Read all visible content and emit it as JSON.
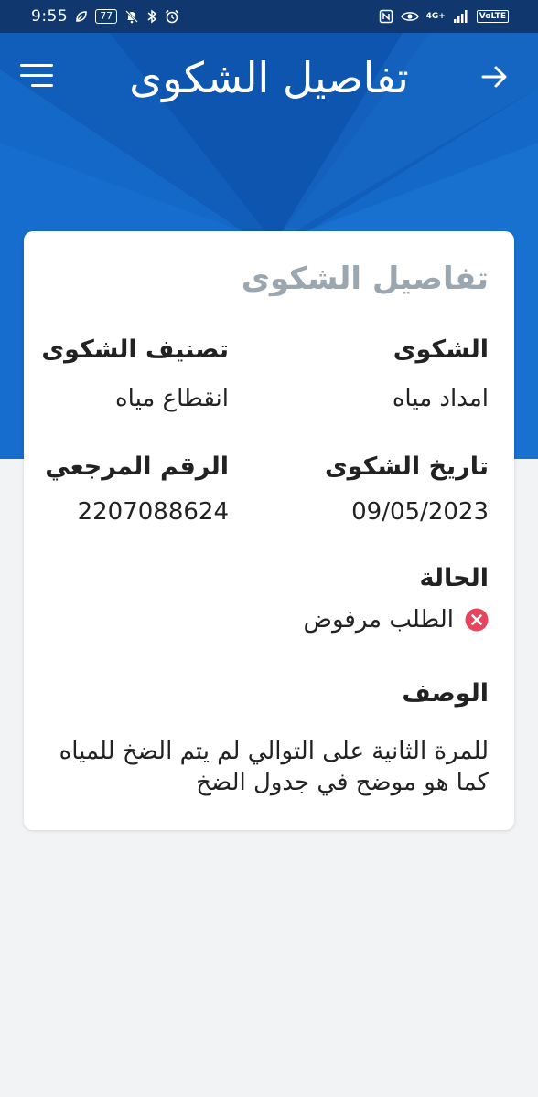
{
  "status_bar": {
    "time": "9:55",
    "battery": "77",
    "network_label": "4G+",
    "volte_label": "VoLTE",
    "icons": [
      "leaf-icon",
      "battery-icon",
      "bell-off-icon",
      "bluetooth-icon",
      "alarm-icon",
      "nfc-icon",
      "eye-icon",
      "signal-icon",
      "volte-badge"
    ]
  },
  "header": {
    "title": "تفاصيل الشكوى",
    "menu_icon": "hamburger-menu-icon",
    "back_icon": "arrow-right-icon"
  },
  "card": {
    "title": "تفاصيل الشكوى",
    "complaint_label": "الشكوى",
    "complaint_value": "امداد مياه",
    "category_label": "تصنيف الشكوى",
    "category_value": "انقطاع مياه",
    "date_label": "تاريخ الشكوى",
    "date_value": "09/05/2023",
    "reference_label": "الرقم المرجعي",
    "reference_value": "2207088624",
    "status_label": "الحالة",
    "status_value": "الطلب مرفوض",
    "status_icon": "rejected-x-icon",
    "description_label": "الوصف",
    "description_value": "للمرة الثانية على التوالي لم يتم الضخ للمياه كما هو موضح في جدول الضخ"
  },
  "colors": {
    "status_bar": "#10386e",
    "header_blue": "#1469c8",
    "card_title": "#9aa6b0",
    "reject_red": "#e5465d",
    "page_background": "#f2f3f5"
  }
}
